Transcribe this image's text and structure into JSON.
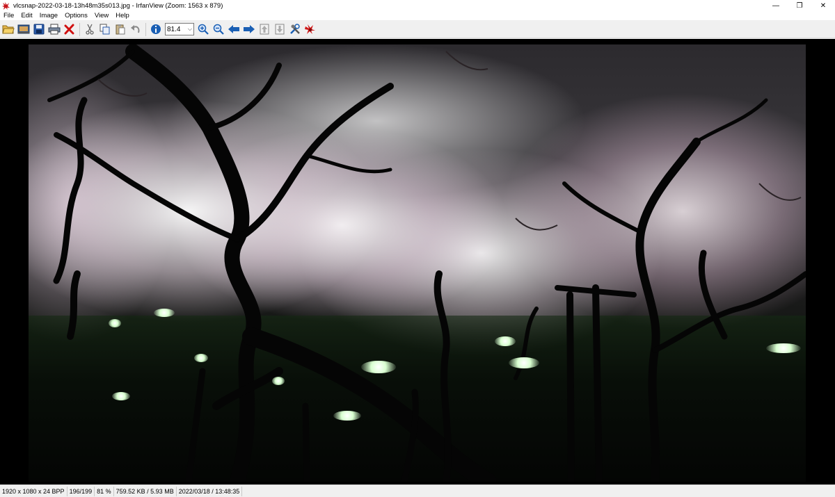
{
  "window": {
    "title": "vlcsnap-2022-03-18-13h48m35s013.jpg - IrfanView (Zoom: 1563 x 879)",
    "minimize_glyph": "—",
    "maximize_glyph": "❐",
    "close_glyph": "✕"
  },
  "menu": {
    "items": [
      "File",
      "Edit",
      "Image",
      "Options",
      "View",
      "Help"
    ]
  },
  "toolbar": {
    "zoom_value": "81.4",
    "icons": [
      "open-folder-icon",
      "slideshow-icon",
      "save-icon",
      "print-icon",
      "delete-icon",
      "cut-icon",
      "copy-icon",
      "paste-icon",
      "undo-icon",
      "info-icon",
      "zoom-in-icon",
      "zoom-out-icon",
      "previous-icon",
      "next-icon",
      "first-file-icon",
      "last-file-icon",
      "settings-icon",
      "irfanview-logo-icon"
    ]
  },
  "statusbar": {
    "dimensions": "1920 x 1080 x 24 BPP",
    "file_index": "196/199",
    "zoom_percent": "81 %",
    "file_size": "759.52 KB / 5.93 MB",
    "datetime": "2022/03/18 / 13:48:35"
  },
  "colors": {
    "toolbar_bg": "#f0f0f0",
    "viewport_bg": "#000000",
    "accent_blue": "#1a5fb4",
    "delete_red": "#d01010"
  }
}
